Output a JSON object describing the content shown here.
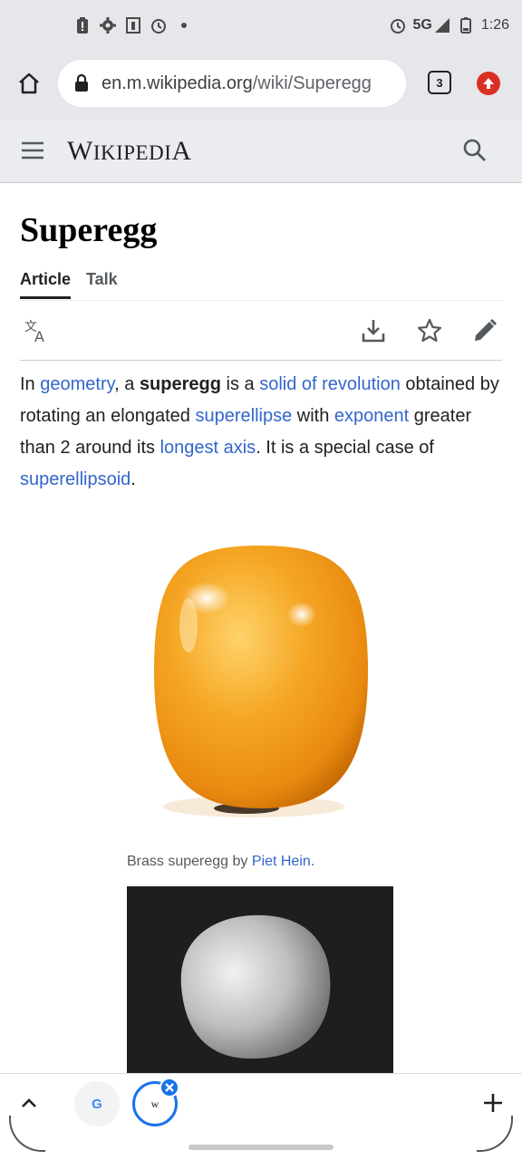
{
  "status_bar": {
    "network": "5G",
    "time": "1:26"
  },
  "browser": {
    "url_domain": "en.m.wikipedia.org",
    "url_path": "/wiki/Superegg",
    "tab_count": "3"
  },
  "wiki_header": {
    "wordmark_first": "W",
    "wordmark_rest": "IKIPEDI",
    "wordmark_last": "A"
  },
  "article": {
    "title": "Superegg",
    "tabs": [
      {
        "label": "Article",
        "active": true
      },
      {
        "label": "Talk",
        "active": false
      }
    ],
    "intro": {
      "t1": "In ",
      "l1": "geometry",
      "t2": ", a ",
      "b1": "superegg",
      "t3": " is a ",
      "l2": "solid of revolution",
      "t4": " obtained by rotating an elongated ",
      "l3": "superellipse",
      "t5": " with ",
      "l4": "exponent",
      "t6": " greater than 2 around its ",
      "l5": "longest axis",
      "t7": ". It is a special case of ",
      "l6": "superellipsoid",
      "t8": "."
    },
    "figure1_caption_text": "Brass superegg by ",
    "figure1_caption_link": "Piet Hein",
    "figure1_caption_end": "."
  },
  "bottom_bar": {
    "tab1_label": "G",
    "tab2_label": "w"
  },
  "colors": {
    "link": "#3366cc",
    "brass": "#f5a623",
    "tab_ring": "#1a73e8"
  }
}
